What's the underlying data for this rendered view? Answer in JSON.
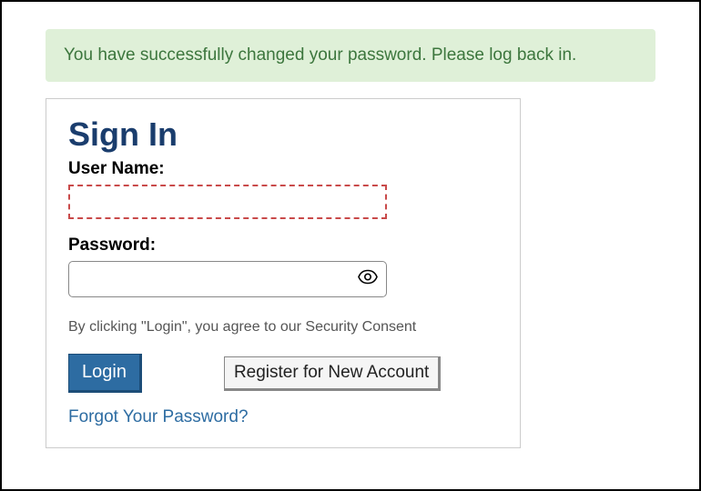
{
  "alert": {
    "message": "You have successfully changed your password. Please log back in."
  },
  "signin": {
    "title": "Sign In",
    "username_label": "User Name:",
    "password_label": "Password:",
    "consent_text": "By clicking \"Login\", you agree to our Security Consent",
    "login_button": "Login",
    "register_button": "Register for New Account",
    "forgot_link": "Forgot Your Password?"
  }
}
